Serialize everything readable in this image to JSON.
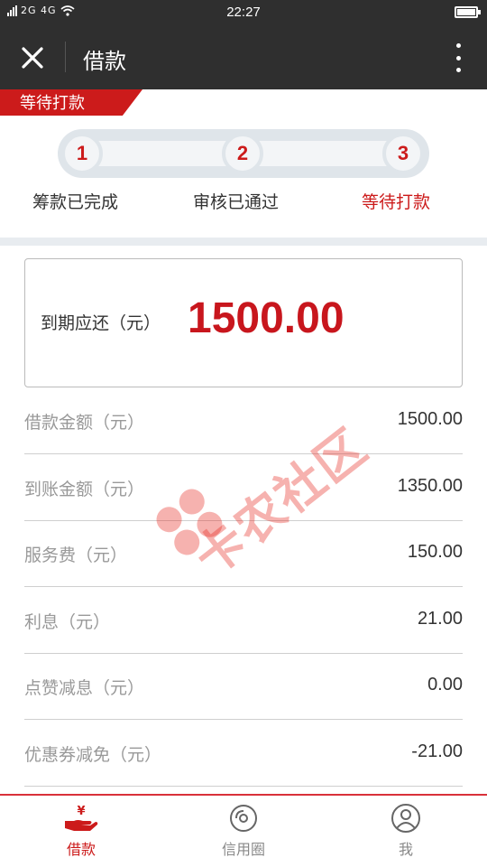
{
  "status_bar": {
    "left_text": "2G 4G",
    "time": "22:27"
  },
  "nav": {
    "title": "借款",
    "close_icon": "close-icon",
    "more_icon": "more-vertical-icon"
  },
  "status_ribbon": "等待打款",
  "progress": {
    "steps": [
      {
        "number": "1",
        "label": "筹款已完成",
        "state": "done"
      },
      {
        "number": "2",
        "label": "审核已通过",
        "state": "done"
      },
      {
        "number": "3",
        "label": "等待打款",
        "state": "current"
      }
    ]
  },
  "due": {
    "label": "到期应还（元）",
    "value": "1500.00"
  },
  "details": [
    {
      "label": "借款金额（元）",
      "value": "1500.00"
    },
    {
      "label": "到账金额（元）",
      "value": "1350.00"
    },
    {
      "label": "服务费（元）",
      "value": "150.00"
    },
    {
      "label": "利息（元）",
      "value": "21.00"
    },
    {
      "label": "点赞减息（元）",
      "value": "0.00"
    },
    {
      "label": "优惠券减免（元）",
      "value": "-21.00"
    }
  ],
  "watermark": "卡农社区",
  "tabs": [
    {
      "label": "借款",
      "icon": "loan-hand-yen-icon",
      "active": true
    },
    {
      "label": "信用圈",
      "icon": "credit-circle-icon",
      "active": false
    },
    {
      "label": "我",
      "icon": "profile-icon",
      "active": false
    }
  ],
  "colors": {
    "accent": "#cc1b1b",
    "header": "#2f2f2f",
    "band": "#e8ecf0"
  }
}
